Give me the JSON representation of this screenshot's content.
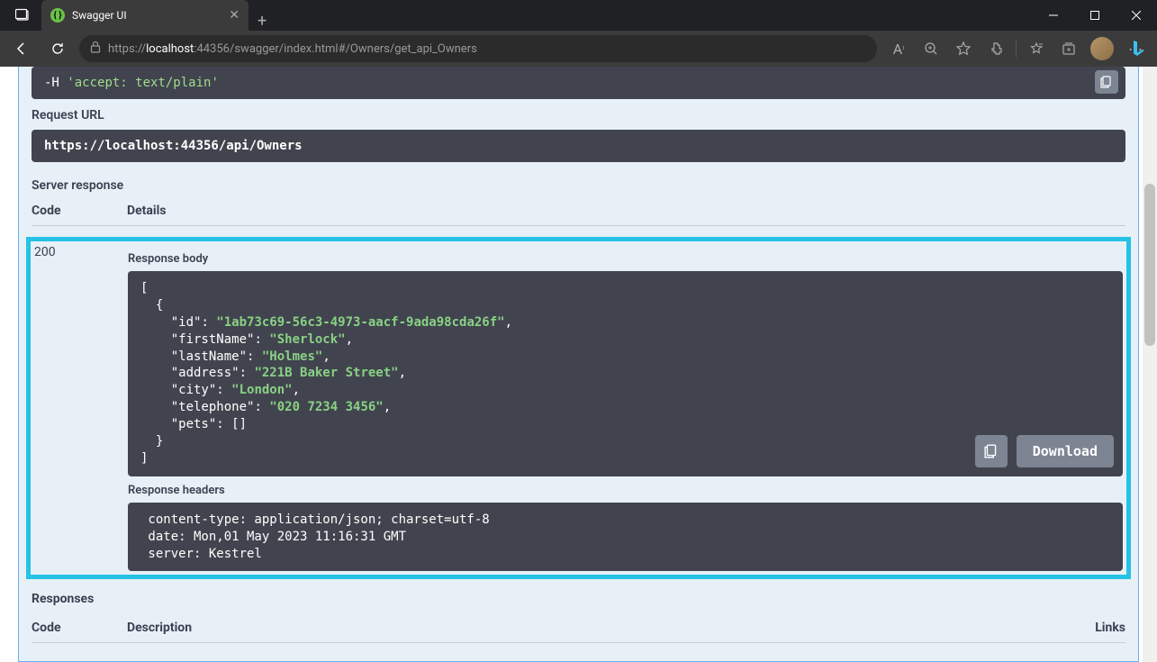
{
  "browser": {
    "tab_title": "Swagger UI",
    "url_prefix": "https://",
    "url_host": "localhost",
    "url_port_path": ":44356/swagger/index.html#/Owners/get_api_Owners"
  },
  "curl": {
    "flag": "-H",
    "value": "'accept: text/plain'"
  },
  "sections": {
    "request_url": "Request URL",
    "server_response": "Server response",
    "response_body": "Response body",
    "response_headers": "Response headers",
    "responses": "Responses"
  },
  "request_url_value": "https://localhost:44356/api/Owners",
  "table_headers": {
    "code": "Code",
    "details": "Details",
    "description": "Description",
    "links": "Links"
  },
  "response": {
    "status": "200",
    "body_lines": [
      {
        "indent": 0,
        "t": "punct",
        "text": "["
      },
      {
        "indent": 1,
        "t": "punct",
        "text": "{"
      },
      {
        "indent": 2,
        "t": "kv",
        "key": "\"id\"",
        "val": "\"1ab73c69-56c3-4973-aacf-9ada98cda26f\"",
        "trail": ","
      },
      {
        "indent": 2,
        "t": "kv",
        "key": "\"firstName\"",
        "val": "\"Sherlock\"",
        "trail": ","
      },
      {
        "indent": 2,
        "t": "kv",
        "key": "\"lastName\"",
        "val": "\"Holmes\"",
        "trail": ","
      },
      {
        "indent": 2,
        "t": "kv",
        "key": "\"address\"",
        "val": "\"221B Baker Street\"",
        "trail": ","
      },
      {
        "indent": 2,
        "t": "kv",
        "key": "\"city\"",
        "val": "\"London\"",
        "trail": ","
      },
      {
        "indent": 2,
        "t": "kv",
        "key": "\"telephone\"",
        "val": "\"020 7234 3456\"",
        "trail": ","
      },
      {
        "indent": 2,
        "t": "kraw",
        "key": "\"pets\"",
        "raw": "[]",
        "trail": ""
      },
      {
        "indent": 1,
        "t": "punct",
        "text": "}"
      },
      {
        "indent": 0,
        "t": "punct",
        "text": "]"
      }
    ],
    "download_label": "Download",
    "headers_lines": [
      " content-type: application/json; charset=utf-8 ",
      " date: Mon,01 May 2023 11:16:31 GMT ",
      " server: Kestrel "
    ]
  }
}
